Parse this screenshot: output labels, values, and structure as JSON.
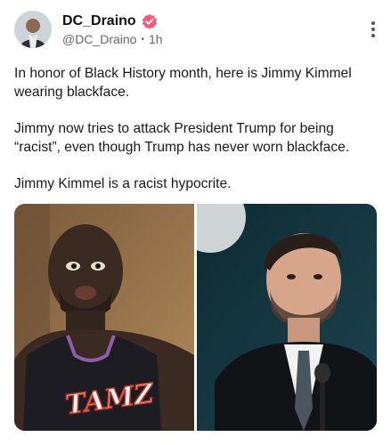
{
  "post": {
    "author": {
      "display_name": "DC_Draino",
      "handle": "@DC_Draino",
      "verified": true,
      "verified_color": "#f25a7a"
    },
    "time_separator": "•",
    "time": "1h",
    "paragraphs": [
      "In honor of Black History month, here is Jimmy Kimmel wearing blackface.",
      "Jimmy now tries to attack President Trump for being “racist”, even though Trump has never worn blackface.",
      "Jimmy Kimmel is a racist hypocrite."
    ],
    "media": [
      {
        "icon": "photo",
        "alt_role": "left-photo"
      },
      {
        "icon": "photo",
        "alt_role": "right-photo"
      }
    ],
    "jersey_text": "TAMZ"
  },
  "icons": {
    "more": "more-vertical-icon",
    "verified": "verified-badge-icon"
  }
}
